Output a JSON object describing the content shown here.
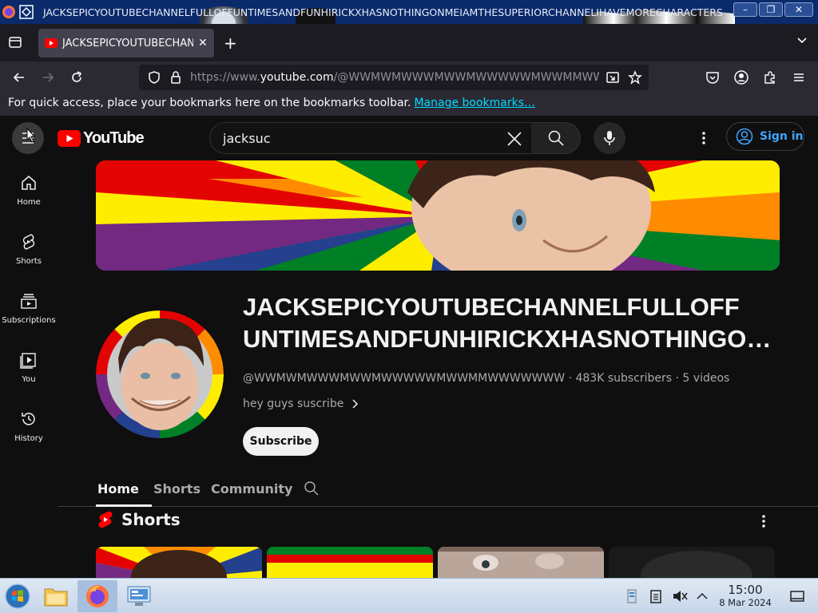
{
  "window": {
    "title": "JACKSEPICYOUTUBECHANNELFULLOFFUNTIMESANDFUNHIRICKXHASNOTHINGONMEIAMTHESUPERIORCHANNELIHAVEMORECHARACTERS",
    "minimize": "–",
    "maximize": "❐",
    "close": "✕"
  },
  "browser": {
    "tab_title": "JACKSEPICYOUTUBECHANNELFULLOFFUNTIMESANDFUN",
    "url_prefix": "https://www.",
    "url_domain": "youtube.com",
    "url_path": "/@WWMWMWWWMWWMWWWWWMWWMMWWWWWWW",
    "bookmarks_text": "For quick access, place your bookmarks here on the bookmarks toolbar.",
    "bookmarks_link": "Manage bookmarks…"
  },
  "youtube": {
    "logo_text": "YouTube",
    "search_query": "jacksuc",
    "sign_in": "Sign in",
    "sidebar": [
      {
        "label": "Home",
        "icon": "home-icon"
      },
      {
        "label": "Shorts",
        "icon": "shorts-icon"
      },
      {
        "label": "Subscriptions",
        "icon": "subscriptions-icon"
      },
      {
        "label": "You",
        "icon": "you-icon"
      },
      {
        "label": "History",
        "icon": "history-icon"
      }
    ],
    "channel": {
      "name_line1": "JACKSEPICYOUTUBECHANNELFULLOFF",
      "name_line2": "UNTIMESANDFUNHIRICKXHASNOTHINGONMEIAMTHESUPERIOR",
      "handle": "@WWMWMWWWMWWMWWWWWMWWMMWWWWWWW",
      "subscribers": "483K subscribers",
      "videos": "5 videos",
      "description": "hey guys suscribe",
      "subscribe_label": "Subscribe"
    },
    "tabs": [
      "Home",
      "Shorts",
      "Community"
    ],
    "active_tab": "Home",
    "shorts_title": "Shorts"
  },
  "taskbar": {
    "time": "15:00",
    "date": "8 Mar 2024"
  },
  "colors": {
    "yt_red": "#ff0000",
    "link_blue": "#3ea6ff",
    "title_bar": "#0a2a6b"
  }
}
